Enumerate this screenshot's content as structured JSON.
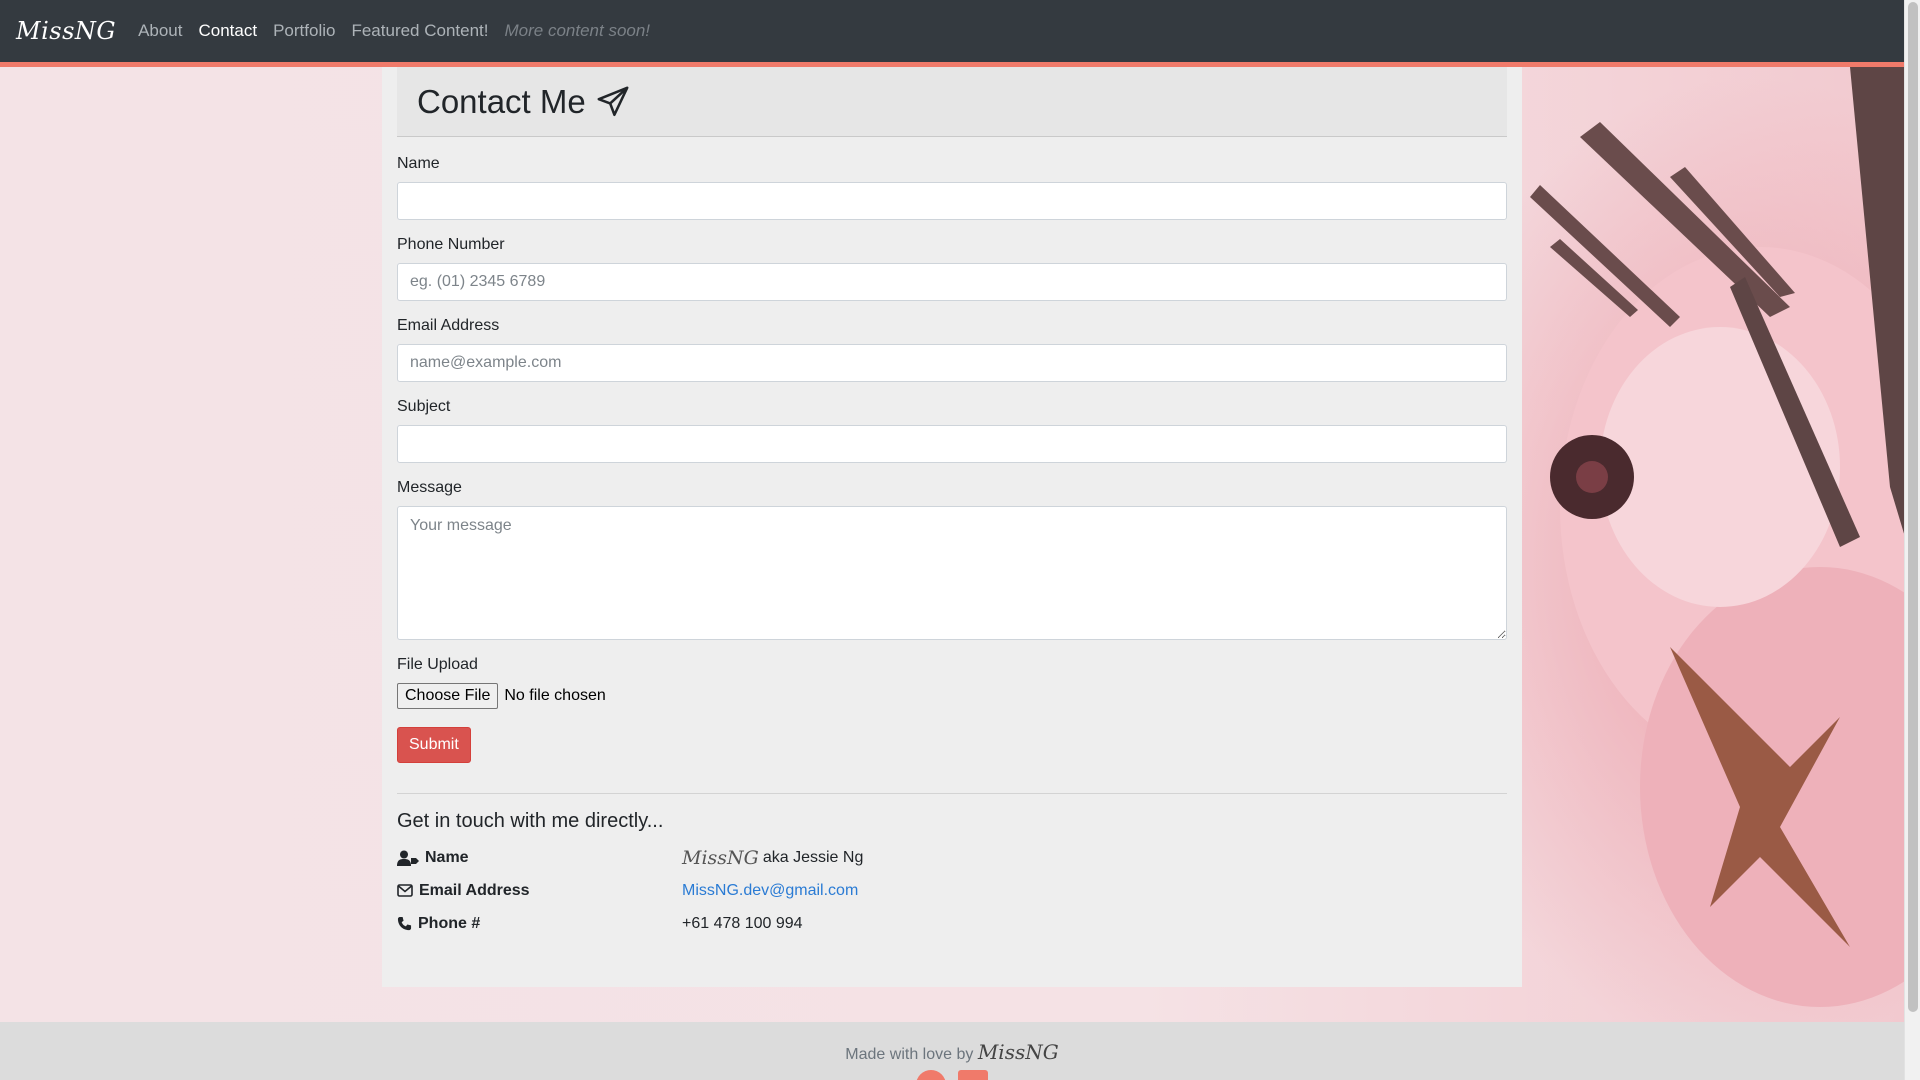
{
  "navbar": {
    "brand": "MissNG",
    "links": [
      {
        "label": "About"
      },
      {
        "label": "Contact"
      },
      {
        "label": "Portfolio"
      },
      {
        "label": "Featured Content!"
      },
      {
        "label": "More content soon!"
      }
    ],
    "bg_color": "#343a40",
    "accent_color": "#f07a6a"
  },
  "header": {
    "title": "Contact Me",
    "icon": "paper-plane-icon"
  },
  "form": {
    "name": {
      "label": "Name",
      "placeholder": "",
      "value": ""
    },
    "phone": {
      "label": "Phone Number",
      "placeholder": "eg. (01) 2345 6789",
      "value": ""
    },
    "email": {
      "label": "Email Address",
      "placeholder": "name@example.com",
      "value": ""
    },
    "subject": {
      "label": "Subject",
      "placeholder": "",
      "value": ""
    },
    "message": {
      "label": "Message",
      "placeholder": "Your message",
      "value": ""
    },
    "file": {
      "label": "File Upload",
      "button": "Choose File",
      "status": "No file chosen"
    },
    "submit": "Submit",
    "submit_color": "#d9534f"
  },
  "direct": {
    "title": "Get in touch with me directly...",
    "rows": [
      {
        "icon": "user-tag-icon",
        "key": "Name",
        "signature": "MissNG",
        "value": "aka Jessie Ng"
      },
      {
        "icon": "envelope-icon",
        "key": "Email Address",
        "value": "MissNG.dev@gmail.com"
      },
      {
        "icon": "phone-icon",
        "key": "Phone #",
        "value": "+61 478 100 994"
      }
    ]
  },
  "footer": {
    "text": "Made with love by",
    "signature": "MissNG",
    "icons": [
      "github-icon",
      "linkedin-icon"
    ]
  }
}
